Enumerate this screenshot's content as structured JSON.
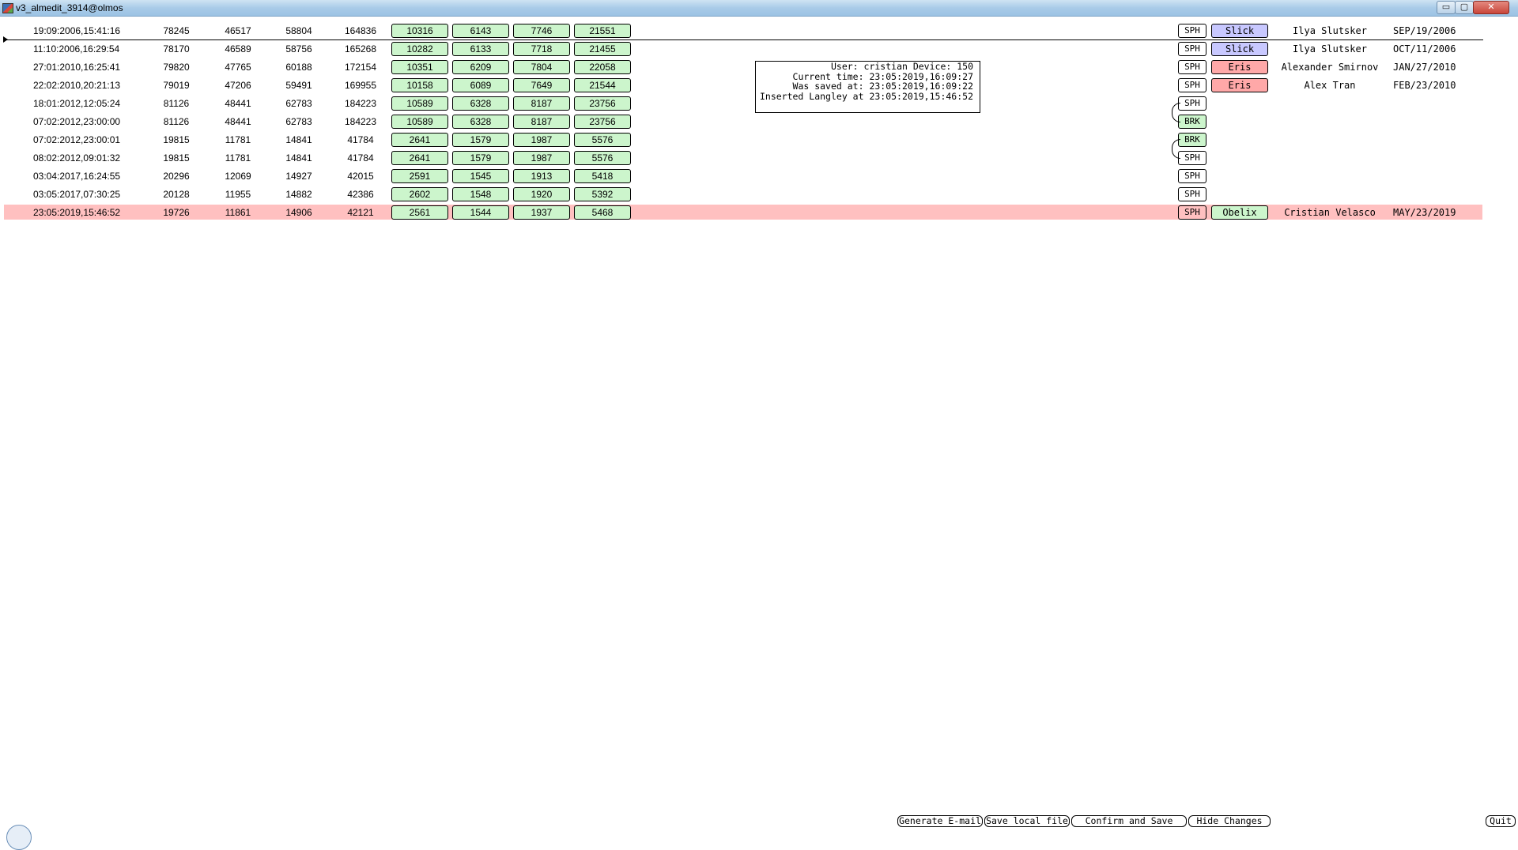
{
  "window": {
    "title": "v3_almedit_3914@olmos",
    "min_glyph": "▭",
    "max_glyph": "▢",
    "close_glyph": "✕"
  },
  "rows": [
    {
      "ts": "19:09:2006,15:41:16",
      "n1": "78245",
      "n2": "46517",
      "n3": "58804",
      "n4": "164836",
      "b1": "10316",
      "b2": "6143",
      "b3": "7746",
      "b4": "21551",
      "tag": "SPH",
      "pill": "Slick",
      "pill_kind": "slick",
      "author": "Ilya Slutsker",
      "date": "SEP/19/2006"
    },
    {
      "ts": "11:10:2006,16:29:54",
      "n1": "78170",
      "n2": "46589",
      "n3": "58756",
      "n4": "165268",
      "b1": "10282",
      "b2": "6133",
      "b3": "7718",
      "b4": "21455",
      "tag": "SPH",
      "pill": "Slick",
      "pill_kind": "slick",
      "author": "Ilya Slutsker",
      "date": "OCT/11/2006"
    },
    {
      "ts": "27:01:2010,16:25:41",
      "n1": "79820",
      "n2": "47765",
      "n3": "60188",
      "n4": "172154",
      "b1": "10351",
      "b2": "6209",
      "b3": "7804",
      "b4": "22058",
      "tag": "SPH",
      "pill": "Eris",
      "pill_kind": "eris",
      "author": "Alexander Smirnov",
      "date": "JAN/27/2010"
    },
    {
      "ts": "22:02:2010,20:21:13",
      "n1": "79019",
      "n2": "47206",
      "n3": "59491",
      "n4": "169955",
      "b1": "10158",
      "b2": "6089",
      "b3": "7649",
      "b4": "21544",
      "tag": "SPH",
      "pill": "Eris",
      "pill_kind": "eris",
      "author": "Alex Tran",
      "date": "FEB/23/2010"
    },
    {
      "ts": "18:01:2012,12:05:24",
      "n1": "81126",
      "n2": "48441",
      "n3": "62783",
      "n4": "184223",
      "b1": "10589",
      "b2": "6328",
      "b3": "8187",
      "b4": "23756",
      "tag": "SPH",
      "pill": "",
      "pill_kind": "",
      "author": "",
      "date": ""
    },
    {
      "ts": "07:02:2012,23:00:00",
      "n1": "81126",
      "n2": "48441",
      "n3": "62783",
      "n4": "184223",
      "b1": "10589",
      "b2": "6328",
      "b3": "8187",
      "b4": "23756",
      "tag": "BRK",
      "pill": "",
      "pill_kind": "",
      "author": "",
      "date": ""
    },
    {
      "ts": "07:02:2012,23:00:01",
      "n1": "19815",
      "n2": "11781",
      "n3": "14841",
      "n4": "41784",
      "b1": "2641",
      "b2": "1579",
      "b3": "1987",
      "b4": "5576",
      "tag": "BRK",
      "pill": "",
      "pill_kind": "",
      "author": "",
      "date": ""
    },
    {
      "ts": "08:02:2012,09:01:32",
      "n1": "19815",
      "n2": "11781",
      "n3": "14841",
      "n4": "41784",
      "b1": "2641",
      "b2": "1579",
      "b3": "1987",
      "b4": "5576",
      "tag": "SPH",
      "pill": "",
      "pill_kind": "",
      "author": "",
      "date": ""
    },
    {
      "ts": "03:04:2017,16:24:55",
      "n1": "20296",
      "n2": "12069",
      "n3": "14927",
      "n4": "42015",
      "b1": "2591",
      "b2": "1545",
      "b3": "1913",
      "b4": "5418",
      "tag": "SPH",
      "pill": "",
      "pill_kind": "",
      "author": "",
      "date": ""
    },
    {
      "ts": "03:05:2017,07:30:25",
      "n1": "20128",
      "n2": "11955",
      "n3": "14882",
      "n4": "42386",
      "b1": "2602",
      "b2": "1548",
      "b3": "1920",
      "b4": "5392",
      "tag": "SPH",
      "pill": "",
      "pill_kind": "",
      "author": "",
      "date": ""
    },
    {
      "ts": "23:05:2019,15:46:52",
      "n1": "19726",
      "n2": "11861",
      "n3": "14906",
      "n4": "42121",
      "b1": "2561",
      "b2": "1544",
      "b3": "1937",
      "b4": "5468",
      "tag": "SPH",
      "pill": "Obelix",
      "pill_kind": "obelix",
      "author": "Cristian Velasco",
      "date": "MAY/23/2019",
      "current": true
    }
  ],
  "info": {
    "user_line": "User: cristian Device: 150",
    "current_time": "Current time: 23:05:2019,16:09:27",
    "saved_at": "Was saved at: 23:05:2019,16:09:22",
    "inserted": "Inserted Langley at 23:05:2019,15:46:52"
  },
  "buttons": {
    "generate_email": "Generate E-mail",
    "save_local": "Save local file",
    "confirm_save": "Confirm and Save",
    "hide_changes": "Hide Changes",
    "quit": "Quit"
  },
  "colors": {
    "current_row": "#ffc0c0",
    "value_box": "#ccf5cc",
    "slick": "#c8c8ff",
    "eris": "#ffa8a8",
    "obelix": "#ccf5cc"
  }
}
